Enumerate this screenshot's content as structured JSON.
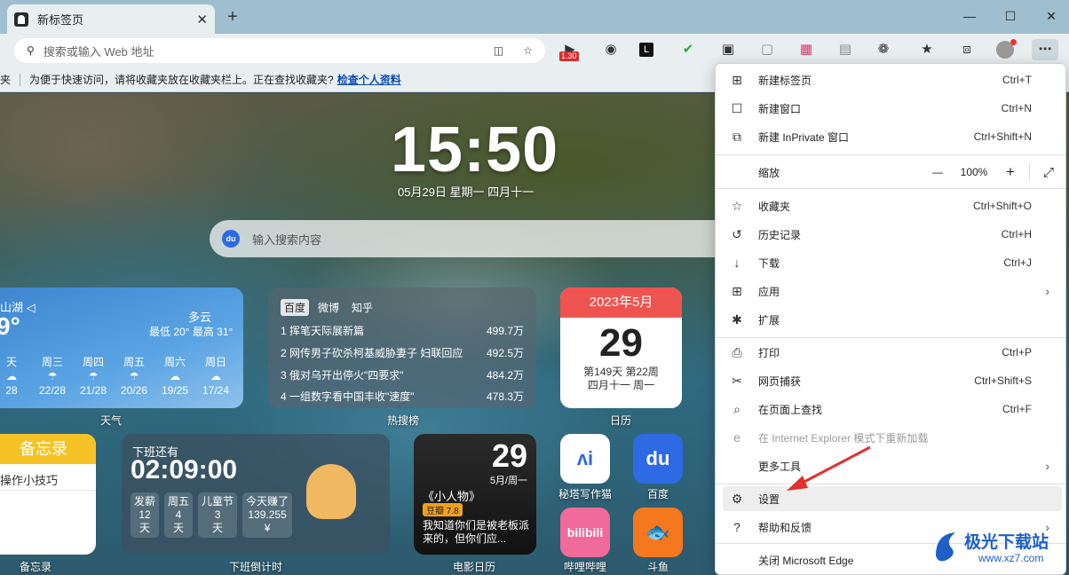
{
  "tab": {
    "title": "新标签页",
    "close": "✕",
    "new": "+"
  },
  "window": {
    "minimize": "—",
    "maximize": "☐",
    "close": "✕"
  },
  "address": {
    "placeholder": "搜索或输入 Web 地址"
  },
  "toolbar": {
    "badge": "1.30"
  },
  "favbar": {
    "prefix": "夹",
    "text": "为便于快速访问，请将收藏夹放在收藏夹栏上。正在查找收藏夹?",
    "link": "检查个人资料"
  },
  "clock": {
    "time": "15:50",
    "date": "05月29日  星期一  四月十一"
  },
  "search": {
    "placeholder": "输入搜索内容",
    "logo": "du"
  },
  "weather": {
    "location": "山湖 ◁",
    "temp": "9°",
    "condition": "多云",
    "range": "最低 20° 最高 31°",
    "days": [
      {
        "name": "天",
        "temp": "28"
      },
      {
        "name": "周三",
        "temp": "22/28"
      },
      {
        "name": "周四",
        "temp": "21/28"
      },
      {
        "name": "周五",
        "temp": "20/26"
      },
      {
        "name": "周六",
        "temp": "19/25"
      },
      {
        "name": "周日",
        "temp": "17/24"
      }
    ],
    "label": "天气"
  },
  "hot": {
    "tabs": [
      "百度",
      "微博",
      "知乎"
    ],
    "items": [
      {
        "title": "1  挥笔天际展新篇",
        "value": "499.7万"
      },
      {
        "title": "2  网传男子砍杀柯基威胁妻子 妇联回应",
        "value": "492.5万"
      },
      {
        "title": "3  俄对乌开出停火\"四要求\"",
        "value": "484.2万"
      },
      {
        "title": "4  一组数字看中国丰收\"速度\"",
        "value": "478.3万"
      }
    ],
    "label": "热搜榜"
  },
  "calendar": {
    "header": "2023年5月",
    "day": "29",
    "week": "第149天 第22周",
    "lunar": "四月十一 周一",
    "label": "日历"
  },
  "memo": {
    "header": "备忘录",
    "item": "操作小技巧",
    "label": "备忘录"
  },
  "countdown": {
    "title": "下班还有",
    "time": "02:09:00",
    "boxes": [
      {
        "a": "发薪",
        "b": "12",
        "c": "天"
      },
      {
        "a": "周五",
        "b": "4",
        "c": "天"
      },
      {
        "a": "儿童节",
        "b": "3",
        "c": "天"
      },
      {
        "a": "今天赚了",
        "b": "139.255",
        "c": "¥"
      }
    ],
    "label": "下班倒计时"
  },
  "movie": {
    "day": "29",
    "month": "5月/周一",
    "name": "《小人物》",
    "score": "豆瓣 7.8",
    "desc": "我知道你们是被老板派来的，但你们应...",
    "label": "电影日历"
  },
  "apps": [
    {
      "label": "秘塔写作猫",
      "glyph": "ʌi"
    },
    {
      "label": "百度",
      "glyph": "du"
    },
    {
      "label": "哔哩哔哩",
      "glyph": "bilibili"
    },
    {
      "label": "斗鱼",
      "glyph": "🐟"
    }
  ],
  "menu": {
    "items": [
      {
        "icon": "⊞",
        "label": "新建标签页",
        "shortcut": "Ctrl+T"
      },
      {
        "icon": "☐",
        "label": "新建窗口",
        "shortcut": "Ctrl+N"
      },
      {
        "icon": "⧉",
        "label": "新建 InPrivate 窗口",
        "shortcut": "Ctrl+Shift+N"
      },
      {
        "icon": "☆",
        "label": "收藏夹",
        "shortcut": "Ctrl+Shift+O"
      },
      {
        "icon": "↺",
        "label": "历史记录",
        "shortcut": "Ctrl+H"
      },
      {
        "icon": "↓",
        "label": "下载",
        "shortcut": "Ctrl+J"
      },
      {
        "icon": "⊞",
        "label": "应用",
        "shortcut": ""
      },
      {
        "icon": "✱",
        "label": "扩展",
        "shortcut": ""
      },
      {
        "icon": "⎙",
        "label": "打印",
        "shortcut": "Ctrl+P"
      },
      {
        "icon": "✂",
        "label": "网页捕获",
        "shortcut": "Ctrl+Shift+S"
      },
      {
        "icon": "⌕",
        "label": "在页面上查找",
        "shortcut": "Ctrl+F"
      },
      {
        "icon": "e",
        "label": "在 Internet Explorer 模式下重新加载",
        "shortcut": ""
      },
      {
        "icon": "",
        "label": "更多工具",
        "shortcut": ""
      },
      {
        "icon": "⚙",
        "label": "设置",
        "shortcut": ""
      },
      {
        "icon": "?",
        "label": "帮助和反馈",
        "shortcut": ""
      },
      {
        "icon": "",
        "label": "关闭 Microsoft Edge",
        "shortcut": ""
      }
    ],
    "zoom": {
      "label": "缩放",
      "minus": "—",
      "value": "100%",
      "plus": "+",
      "fullscreen": "⤢"
    },
    "submenu_arrow": "›"
  },
  "watermark": {
    "title": "极光下载站",
    "url": "www.xz7.com"
  },
  "colors": {
    "accent": "#1e5fc8",
    "arrow": "#e03030",
    "calendar": "#ef5350",
    "memo": "#f6c326"
  }
}
